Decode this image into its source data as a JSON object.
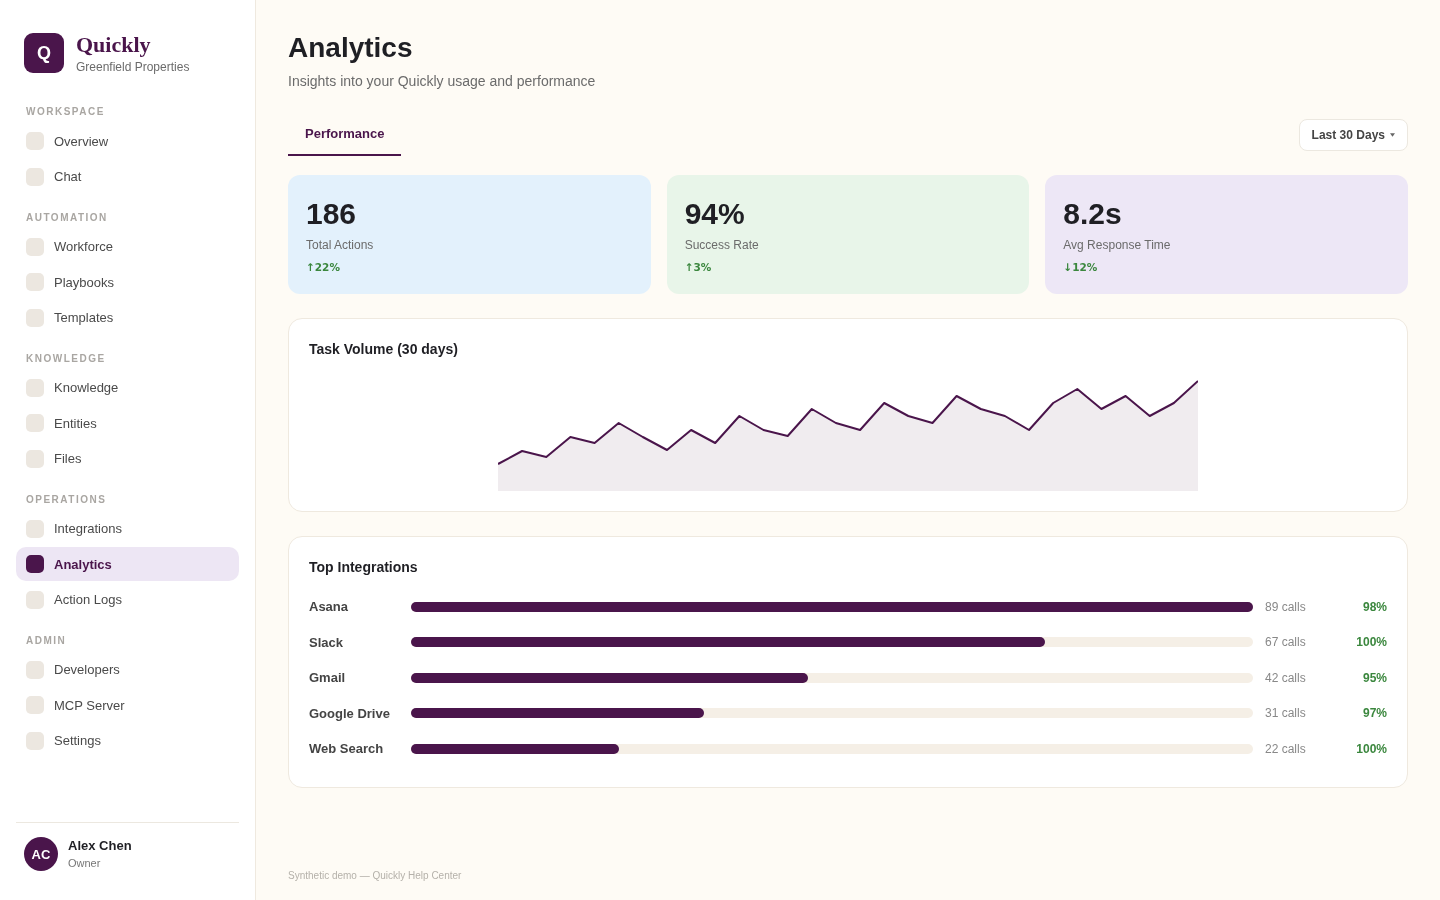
{
  "sidebar": {
    "brand": {
      "logo": "Q",
      "name": "Quickly",
      "organization": "Greenfield Properties"
    },
    "sections": [
      {
        "title": "WORKSPACE",
        "items": [
          {
            "label": "Overview",
            "selected": false
          },
          {
            "label": "Chat",
            "selected": false
          }
        ]
      },
      {
        "title": "AUTOMATION",
        "items": [
          {
            "label": "Workforce",
            "selected": false
          },
          {
            "label": "Playbooks",
            "selected": false
          },
          {
            "label": "Templates",
            "selected": false
          }
        ]
      },
      {
        "title": "KNOWLEDGE",
        "items": [
          {
            "label": "Knowledge",
            "selected": false
          },
          {
            "label": "Entities",
            "selected": false
          },
          {
            "label": "Files",
            "selected": false
          }
        ]
      },
      {
        "title": "OPERATIONS",
        "items": [
          {
            "label": "Integrations",
            "selected": false
          },
          {
            "label": "Analytics",
            "selected": true
          },
          {
            "label": "Action Logs",
            "selected": false
          }
        ]
      },
      {
        "title": "ADMIN",
        "items": [
          {
            "label": "Developers",
            "selected": false
          },
          {
            "label": "MCP Server",
            "selected": false
          },
          {
            "label": "Settings",
            "selected": false
          }
        ]
      }
    ],
    "user": {
      "initials": "AC",
      "name": "Alex Chen",
      "role": "Owner"
    }
  },
  "header": {
    "title": "Analytics",
    "subtitle": "Insights into your Quickly usage and performance"
  },
  "tabs": [
    {
      "label": "Performance",
      "selected": true
    }
  ],
  "date_range": {
    "label": "Last 30 Days"
  },
  "metrics": [
    {
      "value": "186",
      "label": "Total Actions",
      "change": "↑22%",
      "color": "#e3f1fc"
    },
    {
      "value": "94%",
      "label": "Success Rate",
      "change": "↑3%",
      "color": "#e8f5e9"
    },
    {
      "value": "8.2s",
      "label": "Avg Response Time",
      "change": "↓12%",
      "color": "#ede7f6"
    }
  ],
  "task_volume": {
    "title": "Task Volume (30 days)"
  },
  "top_integrations": {
    "title": "Top Integrations",
    "rows": [
      {
        "name": "Asana",
        "level": 1.0,
        "calls": "89 calls",
        "success": "98%"
      },
      {
        "name": "Slack",
        "level": 0.753,
        "calls": "67 calls",
        "success": "100%"
      },
      {
        "name": "Gmail",
        "level": 0.472,
        "calls": "42 calls",
        "success": "95%"
      },
      {
        "name": "Google Drive",
        "level": 0.348,
        "calls": "31 calls",
        "success": "97%"
      },
      {
        "name": "Web Search",
        "level": 0.247,
        "calls": "22 calls",
        "success": "100%"
      }
    ]
  },
  "footer": "Synthetic demo — Quickly Help Center"
}
